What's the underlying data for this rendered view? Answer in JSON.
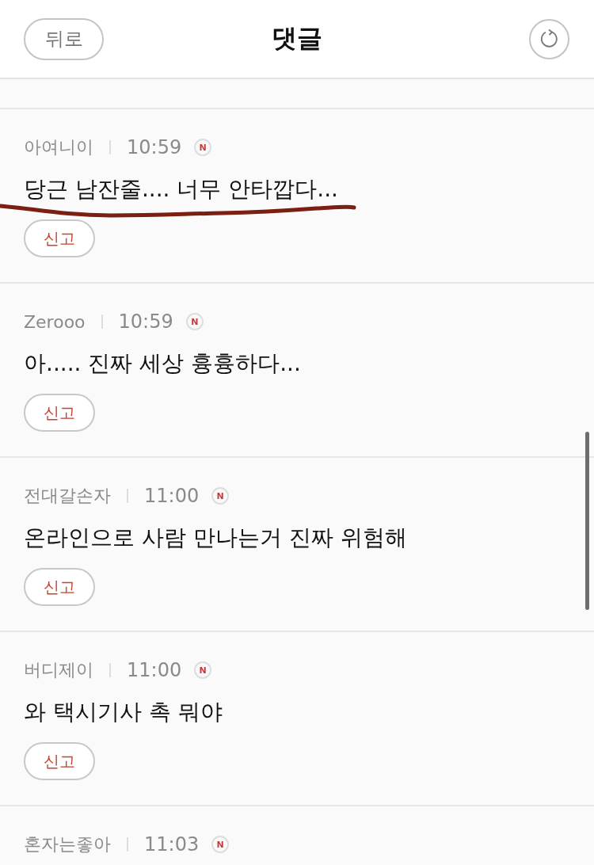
{
  "header": {
    "back_button": "뒤로",
    "title": "댓글"
  },
  "comments": [
    {
      "author": "아여니이",
      "time": "10:59",
      "badge": "N",
      "text": "당근 남잔줄.... 너무 안타깝다...",
      "underlined": true,
      "report_button": "신고"
    },
    {
      "author": "Zerooo",
      "time": "10:59",
      "badge": "N",
      "text": "아..... 진짜 세상 흉흉하다...",
      "underlined": false,
      "report_button": "신고"
    },
    {
      "author": "전대갈손자",
      "time": "11:00",
      "badge": "N",
      "text": "온라인으로 사람 만나는거 진짜 위험해",
      "underlined": false,
      "report_button": "신고"
    },
    {
      "author": "버디제이",
      "time": "11:00",
      "badge": "N",
      "text": "와 택시기사 촉 뭐야",
      "underlined": false,
      "report_button": "신고"
    },
    {
      "author": "혼자는좋아",
      "time": "11:03",
      "badge": "N"
    }
  ]
}
